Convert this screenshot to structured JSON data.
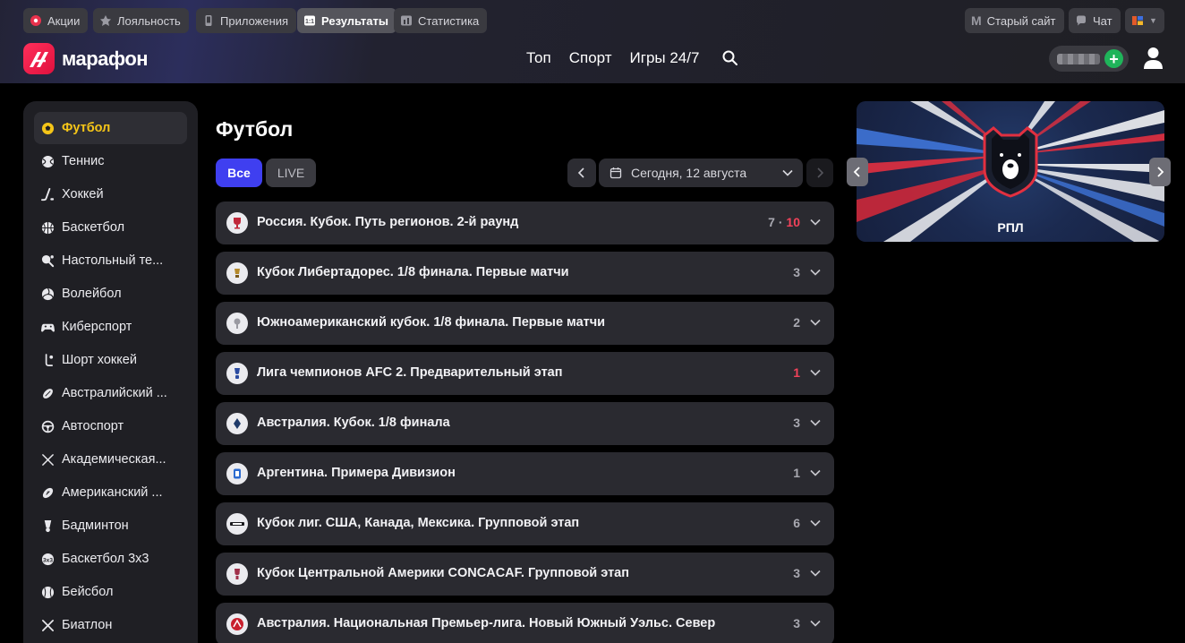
{
  "top_links": [
    {
      "label": "Акции",
      "icon": "promo-icon"
    },
    {
      "label": "Лояльность",
      "icon": "loyalty-icon"
    },
    {
      "label": "Приложения",
      "icon": "phone-icon"
    },
    {
      "label": "Результаты",
      "icon": "results-icon"
    },
    {
      "label": "Статистика",
      "icon": "stats-icon"
    }
  ],
  "top_right": {
    "old_site": "Старый сайт",
    "old_site_icon": "M",
    "chat": "Чат"
  },
  "brand": {
    "name": "марафон",
    "color": "#f0164a"
  },
  "main_nav": [
    "Топ",
    "Спорт",
    "Игры 24/7"
  ],
  "sidebar": {
    "items": [
      {
        "label": "Футбол",
        "icon": "soccer-ball-icon"
      },
      {
        "label": "Теннис",
        "icon": "tennis-ball-icon"
      },
      {
        "label": "Хоккей",
        "icon": "hockey-stick-icon"
      },
      {
        "label": "Баскетбол",
        "icon": "basketball-icon"
      },
      {
        "label": "Настольный те...",
        "icon": "table-tennis-icon"
      },
      {
        "label": "Волейбол",
        "icon": "volleyball-icon"
      },
      {
        "label": "Киберспорт",
        "icon": "gamepad-icon"
      },
      {
        "label": "Шорт хоккей",
        "icon": "short-hockey-icon"
      },
      {
        "label": "Австралийский ...",
        "icon": "aussie-football-icon"
      },
      {
        "label": "Автоспорт",
        "icon": "steering-wheel-icon"
      },
      {
        "label": "Академическая...",
        "icon": "rowing-icon"
      },
      {
        "label": "Американский ...",
        "icon": "american-football-icon"
      },
      {
        "label": "Бадминтон",
        "icon": "shuttlecock-icon"
      },
      {
        "label": "Баскетбол 3x3",
        "icon": "basketball-3x3-icon"
      },
      {
        "label": "Бейсбол",
        "icon": "baseball-icon"
      },
      {
        "label": "Биатлон",
        "icon": "biathlon-icon"
      }
    ]
  },
  "main": {
    "title": "Футбол",
    "filters": {
      "all": "Все",
      "live": "LIVE"
    },
    "date_label": "Сегодня, 12 августа",
    "leagues": [
      {
        "name": "Россия. Кубок. Путь регионов. 2-й раунд",
        "count": "7",
        "sep": " · ",
        "live": "10"
      },
      {
        "name": "Кубок Либертадорес. 1/8 финала. Первые матчи",
        "count": "3",
        "sep": "",
        "live": ""
      },
      {
        "name": "Южноамериканский кубок. 1/8 финала. Первые матчи",
        "count": "2",
        "sep": "",
        "live": ""
      },
      {
        "name": "Лига чемпионов AFC 2. Предварительный этап",
        "count": "",
        "sep": "",
        "live": "1"
      },
      {
        "name": "Австралия. Кубок. 1/8 финала",
        "count": "3",
        "sep": "",
        "live": ""
      },
      {
        "name": "Аргентина. Примера Дивизион",
        "count": "1",
        "sep": "",
        "live": ""
      },
      {
        "name": "Кубок лиг. США, Канада, Мексика. Групповой этап",
        "count": "6",
        "sep": "",
        "live": ""
      },
      {
        "name": "Кубок Центральной Америки CONCACAF. Групповой этап",
        "count": "3",
        "sep": "",
        "live": ""
      },
      {
        "name": "Австралия. Национальная Премьер-лига. Новый Южный Уэльс. Север",
        "count": "3",
        "sep": "",
        "live": ""
      }
    ]
  },
  "banner": {
    "title": "РПЛ"
  },
  "colors": {
    "accent": "#3f3ff0",
    "active_sport": "#f5c518",
    "live": "#f2425a",
    "add": "#1fb45a"
  }
}
